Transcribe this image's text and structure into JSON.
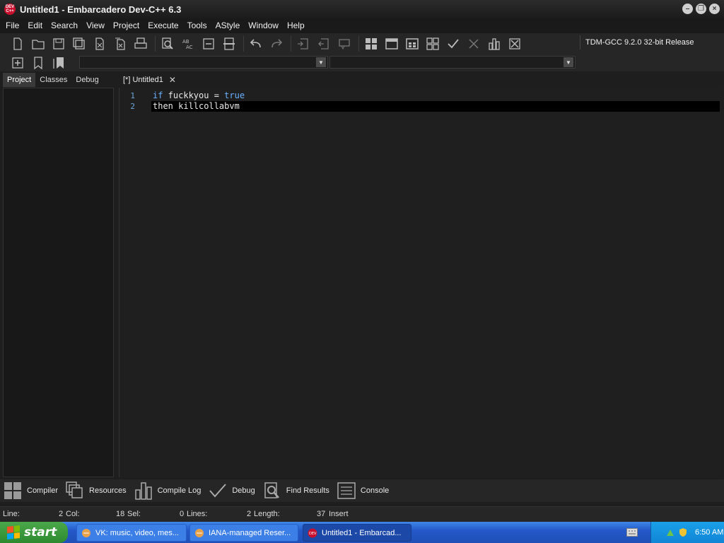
{
  "window": {
    "icon_text": "DEV C++",
    "title": "Untitled1 - Embarcadero Dev-C++ 6.3"
  },
  "menu": [
    "File",
    "Edit",
    "Search",
    "View",
    "Project",
    "Execute",
    "Tools",
    "AStyle",
    "Window",
    "Help"
  ],
  "toolbar": {
    "compiler": "TDM-GCC 9.2.0 32-bit Release"
  },
  "left_panel": {
    "tabs": [
      "Project",
      "Classes",
      "Debug"
    ],
    "active_tab": "Project"
  },
  "editor": {
    "tab_label": "[*] Untitled1",
    "lines": [
      {
        "num": "1",
        "parts": [
          {
            "t": "if",
            "kw": true
          },
          {
            "t": " fuckkyou = ",
            "kw": false
          },
          {
            "t": "true",
            "kw": true
          }
        ]
      },
      {
        "num": "2",
        "parts": [
          {
            "t": "then killcollabvm",
            "kw": false
          }
        ]
      }
    ]
  },
  "bottom_tabs": [
    "Compiler",
    "Resources",
    "Compile Log",
    "Debug",
    "Find Results",
    "Console"
  ],
  "status": {
    "line_label": "Line:",
    "line_value": "2",
    "col_label": "Col:",
    "col_value": "18",
    "sel_label": "Sel:",
    "sel_value": "0",
    "lines_label": "Lines:",
    "lines_value": "2",
    "length_label": "Length:",
    "length_value": "37",
    "mode": "Insert"
  },
  "taskbar": {
    "start_label": "start",
    "tasks": [
      {
        "label": "VK: music, video, mes...",
        "active": false
      },
      {
        "label": "IANA-managed Reser...",
        "active": false
      },
      {
        "label": "Untitled1 - Embarcad...",
        "active": true
      }
    ],
    "clock": "6:50 AM"
  },
  "colors": {
    "keyword": "#6ab0ff",
    "line_number": "#6fa7d8",
    "taskbar": "#2458c9",
    "start": "#2e8a2e"
  }
}
